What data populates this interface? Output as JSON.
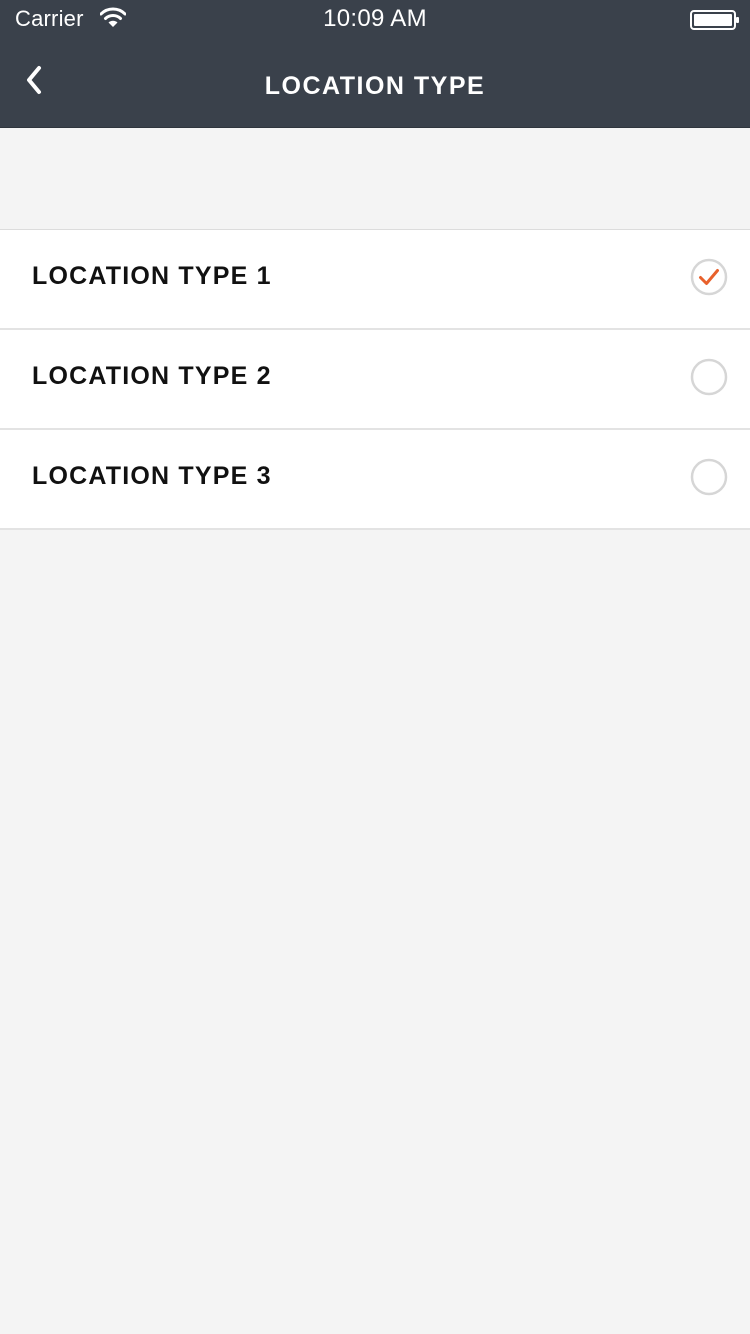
{
  "status_bar": {
    "carrier": "Carrier",
    "time": "10:09 AM",
    "wifi_icon": "wifi-icon",
    "battery_icon": "battery-icon"
  },
  "nav": {
    "back_icon": "chevron-left-icon",
    "title": "LOCATION TYPE"
  },
  "options": [
    {
      "label": "LOCATION TYPE 1",
      "selected": true
    },
    {
      "label": "LOCATION TYPE 2",
      "selected": false
    },
    {
      "label": "LOCATION TYPE 3",
      "selected": false
    }
  ],
  "colors": {
    "header_bg": "#3a414b",
    "accent": "#e8612c",
    "radio_border": "#d6d6d6",
    "page_bg": "#f4f4f4"
  }
}
